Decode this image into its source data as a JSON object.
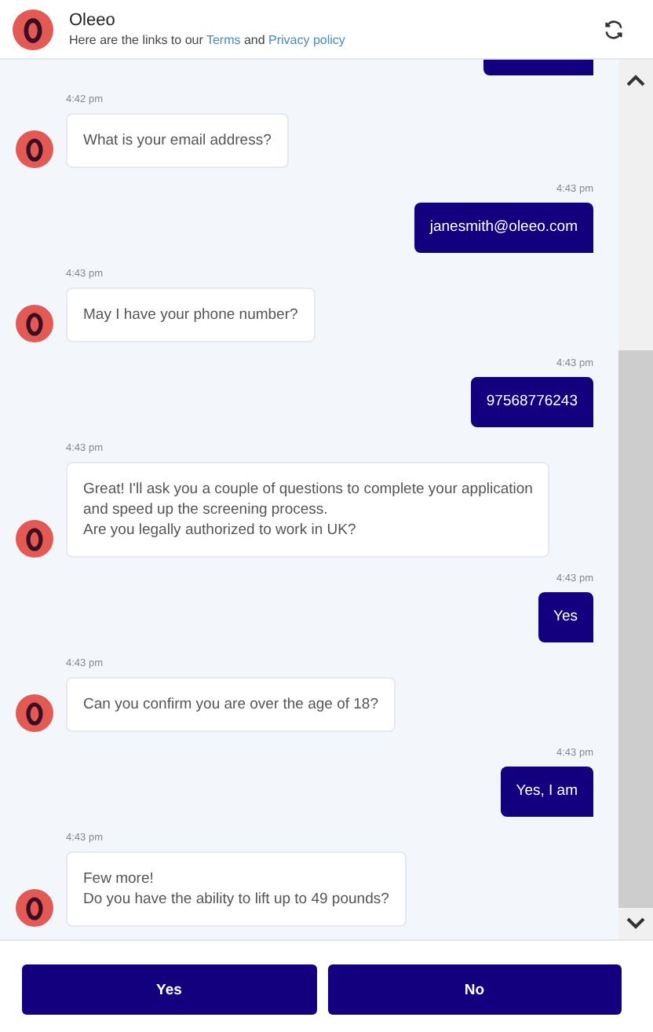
{
  "header": {
    "title": "Oleeo",
    "subtitle_parts": [
      {
        "kind": "text",
        "text": "Here are the links to our "
      },
      {
        "kind": "link",
        "text": "Terms"
      },
      {
        "kind": "text",
        "text": " and "
      },
      {
        "kind": "link",
        "text": "Privacy policy"
      }
    ]
  },
  "chat": {
    "top_bubble_cut": true,
    "messages": [
      {
        "kind": "bot",
        "time": "4:42 pm",
        "lines": [
          "What is your email address?"
        ]
      },
      {
        "kind": "user",
        "time": "4:43 pm",
        "lines": [
          "janesmith@oleeo.com"
        ]
      },
      {
        "kind": "bot",
        "time": "4:43 pm",
        "lines": [
          "May I have your phone number?"
        ]
      },
      {
        "kind": "user",
        "time": "4:43 pm",
        "lines": [
          "97568776243"
        ]
      },
      {
        "kind": "bot",
        "time": "4:43 pm",
        "lines": [
          "Great! I'll ask you a couple of questions to complete your application",
          "and speed up the screening process.",
          "Are you legally authorized to work in UK?"
        ]
      },
      {
        "kind": "user",
        "time": "4:43 pm",
        "lines": [
          "Yes"
        ]
      },
      {
        "kind": "bot",
        "time": "4:43 pm",
        "lines": [
          "Can you confirm you are over the age of 18?"
        ]
      },
      {
        "kind": "user",
        "time": "4:43 pm",
        "lines": [
          "Yes, I am"
        ]
      },
      {
        "kind": "bot",
        "time": "4:43 pm",
        "lines": [
          "Few more!",
          "Do you have the ability to lift up to 49 pounds?"
        ]
      }
    ]
  },
  "replies": [
    "Yes",
    "No"
  ]
}
